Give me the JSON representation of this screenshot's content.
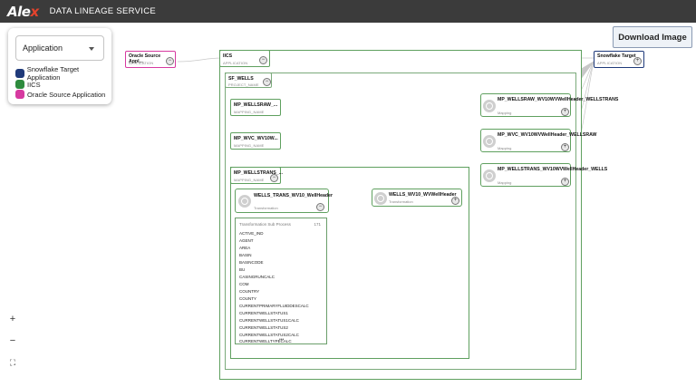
{
  "header": {
    "logo_main": "Ale",
    "logo_accent": "x",
    "title": "DATA LINEAGE SERVICE"
  },
  "toolbar": {
    "download_label": "Download Image"
  },
  "legend": {
    "selected": "Application",
    "items": [
      {
        "label": "Snowflake Target Application",
        "color": "#1f3a7a"
      },
      {
        "label": "IICS",
        "color": "#2e8b3e"
      },
      {
        "label": "Oracle Source Application",
        "color": "#d63aa0"
      }
    ]
  },
  "zoom": {
    "in": "+",
    "out": "−",
    "fit": "⛶"
  },
  "nodes": {
    "oracle": {
      "title": "Oracle Source Appl...",
      "type": "APPLICATION"
    },
    "iics": {
      "title": "IICS",
      "type": "APPLICATION"
    },
    "snowflake": {
      "title": "Snowflake Target",
      "type": "APPLICATION"
    },
    "sf_wells": {
      "title": "SF_WELLS",
      "type": "PROJECT_NAME"
    },
    "mp_wellsraw": {
      "title": "MP_WELLSRAW_...",
      "type": "MAPPING_NAME"
    },
    "mp_wvc": {
      "title": "MP_WVC_WV10W...",
      "type": "MAPPING_NAME"
    },
    "mp_wellstrans": {
      "title": "MP_WELLSTRANS_...",
      "type": "MAPPING_NAME"
    },
    "wells_trans": {
      "title": "WELLS_TRANS_WV10_WellHeader",
      "type": "Transformation"
    },
    "wells_wv10": {
      "title": "WELLS_WV10_WVWellHeader",
      "type": "Transformation"
    },
    "map1": {
      "title": "MP_WELLSRAW_WV10WVWellHeader_WELLSTRANS",
      "type": "Mapping"
    },
    "map2": {
      "title": "MP_WVC_WV10WVWellHeader_WELLSRAW",
      "type": "Mapping"
    },
    "map3": {
      "title": "MP_WELLSTRANS_WV10WVWellHeader_WELLS",
      "type": "Mapping"
    }
  },
  "field_list": {
    "header": "Transformation Sub Process",
    "count": "171",
    "items": [
      "ACTIVE_IND",
      "AGENT",
      "AREA",
      "BASIN",
      "BASINCODE",
      "BU",
      "CASINGRUNCALC",
      "COM",
      "COUNTRY",
      "COUNTY",
      "CURRENTPRIMARYFLUIDDESCALC",
      "CURRENTWELLSTATUS1",
      "CURRENTWELLSTATUS1CALC",
      "CURRENTWELLSTATUS2",
      "CURRENTWELLSTATUS2CALC",
      "CURRENTWELLTYPECALC"
    ],
    "more": "•••"
  },
  "colors": {
    "app_pink": "#d63aa0",
    "app_navy": "#1f3a7a",
    "green": "#2e8b3e",
    "topbar": "#3b3b3b"
  }
}
